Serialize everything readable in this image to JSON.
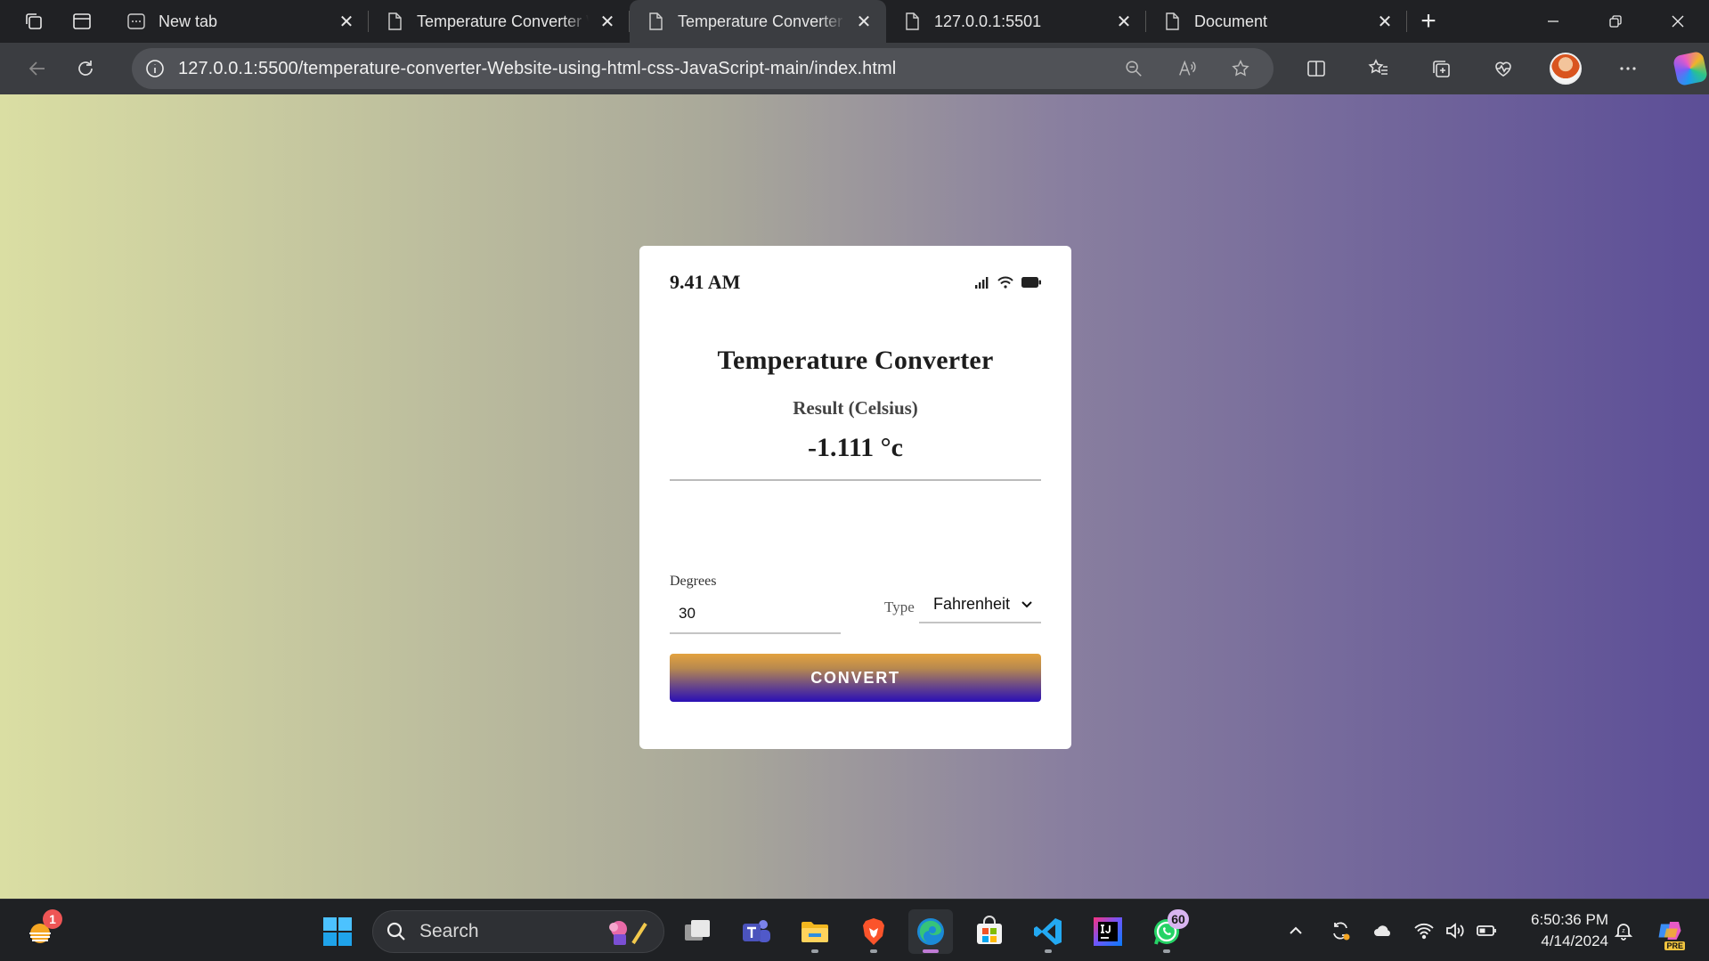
{
  "browser": {
    "tabs": [
      {
        "title": "New tab",
        "favicon": "new-tab-icon",
        "active": false
      },
      {
        "title": "Temperature Converter W",
        "favicon": "page-icon",
        "active": false
      },
      {
        "title": "Temperature Converter W",
        "favicon": "page-icon",
        "active": true
      },
      {
        "title": "127.0.0.1:5501",
        "favicon": "page-icon",
        "active": false
      },
      {
        "title": "Document",
        "favicon": "page-icon",
        "active": false
      }
    ],
    "url": "127.0.0.1:5500/temperature-converter-Website-using-html-css-JavaScript-main/index.html"
  },
  "page": {
    "status_time": "9.41 AM",
    "title": "Temperature Converter",
    "result_label": "Result (Celsius)",
    "result_value": "-1.111 °c",
    "degrees_label": "Degrees",
    "degrees_value": "30",
    "type_label": "Type",
    "type_selected": "Fahrenheit",
    "convert_label": "CONVERT",
    "colors": {
      "background_left": "#dadea3",
      "background_right": "#5c4e97",
      "button_top": "#e3a23f",
      "button_bottom": "#2a0fb6"
    }
  },
  "taskbar": {
    "search_placeholder": "Search",
    "weather_badge": "1",
    "whatsapp_badge": "60",
    "time": "6:50:36 PM",
    "date": "4/14/2024",
    "copilot_label": "PRE"
  }
}
